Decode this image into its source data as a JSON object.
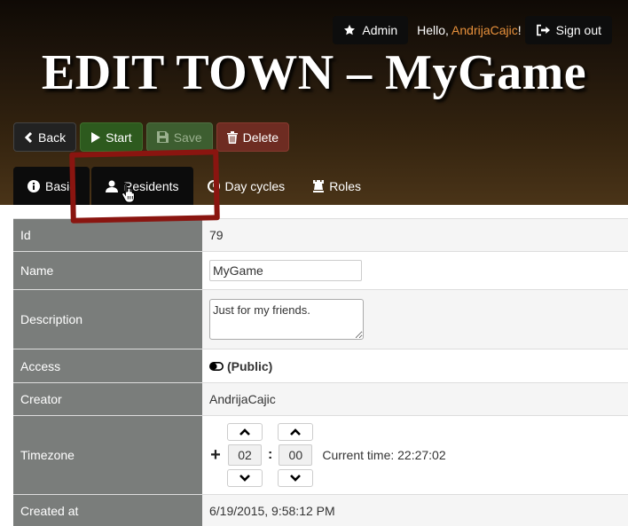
{
  "header": {
    "admin_label": "Admin",
    "hello_prefix": "Hello, ",
    "username": "AndrijaCajic",
    "hello_suffix": "!",
    "signout_label": "Sign out",
    "title": "EDIT TOWN – MyGame"
  },
  "actions": {
    "back": "Back",
    "start": "Start",
    "save": "Save",
    "delete": "Delete"
  },
  "tabs": [
    {
      "label": "Basic"
    },
    {
      "label": "Residents"
    },
    {
      "label": "Day cycles"
    },
    {
      "label": "Roles"
    }
  ],
  "fields": {
    "id_label": "Id",
    "id_value": "79",
    "name_label": "Name",
    "name_value": "MyGame",
    "description_label": "Description",
    "description_value": "Just for my friends.",
    "access_label": "Access",
    "access_value": "(Public)",
    "creator_label": "Creator",
    "creator_value": "AndrijaCajic",
    "timezone_label": "Timezone",
    "tz_hours": "02",
    "tz_minutes": "00",
    "current_time": "Current time: 22:27:02",
    "created_label": "Created at",
    "created_value": "6/19/2015, 9:58:12 PM"
  },
  "colors": {
    "highlight": "#8a1510",
    "username": "#e8913c",
    "label_bg": "#7a7d7b"
  }
}
